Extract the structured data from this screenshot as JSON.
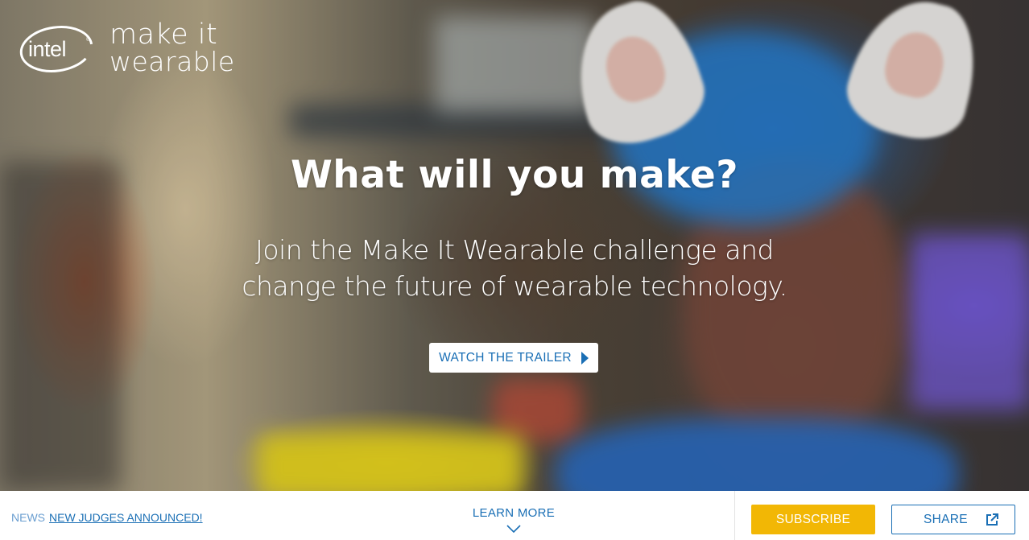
{
  "brand": {
    "logo_text": "intel",
    "tagline_line1": "make it",
    "tagline_line2": "wearable"
  },
  "hero": {
    "headline": "What will you make?",
    "subhead_line1": "Join the Make It Wearable challenge and",
    "subhead_line2": "change the future of wearable technology.",
    "trailer_label": "WATCH THE TRAILER",
    "trailer_icon": "play-icon"
  },
  "bottom_bar": {
    "news_tag": "NEWS",
    "news_link": "NEW JUDGES ANNOUNCED!",
    "learn_more": "LEARN MORE",
    "learn_more_icon": "chevron-down-icon",
    "subscribe_label": "SUBSCRIBE",
    "share_label": "SHARE",
    "share_icon": "external-link-icon"
  },
  "colors": {
    "accent_blue": "#1a6fb5",
    "subscribe_yellow": "#f2b705"
  }
}
